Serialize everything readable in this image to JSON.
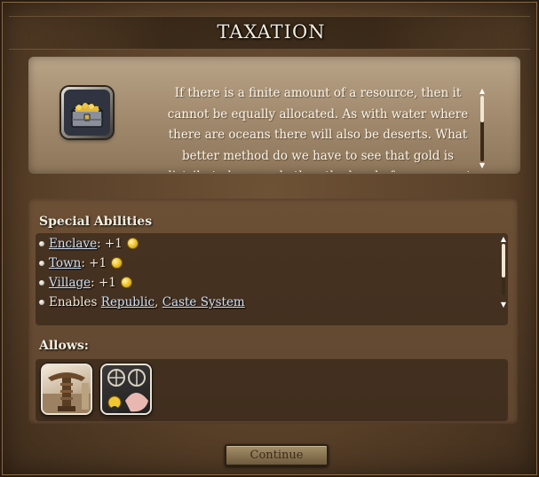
{
  "dialog": {
    "title": "TAXATION",
    "description": "If there is a finite amount of a resource, then it cannot be equally allocated.  As with water where there are oceans there will also be deserts.  What better method do we have to see that gold is distributed unevenly than the hand of government and the",
    "tech_icon": "treasure-chest-icon"
  },
  "special_abilities": {
    "label": "Special Abilities",
    "items": [
      {
        "link": "Enclave",
        "suffix": ": +1",
        "icon": "gold-coin-icon"
      },
      {
        "link": "Town",
        "suffix": ": +1",
        "icon": "gold-coin-icon"
      },
      {
        "link": "Village",
        "suffix": ": +1",
        "icon": "gold-coin-icon"
      },
      {
        "prefix": "Enables ",
        "links": [
          "Republic",
          "Caste System"
        ],
        "separator": ", "
      }
    ]
  },
  "allows": {
    "label": "Allows:",
    "items": [
      {
        "icon": "pillar-monument-icon"
      },
      {
        "icon": "caste-system-icon"
      }
    ]
  },
  "continue_label": "Continue",
  "colors": {
    "panel_bg": "#5a4129",
    "desc_panel": "#a48d70",
    "link": "#cfe0f5",
    "coin": "#f2c832"
  }
}
